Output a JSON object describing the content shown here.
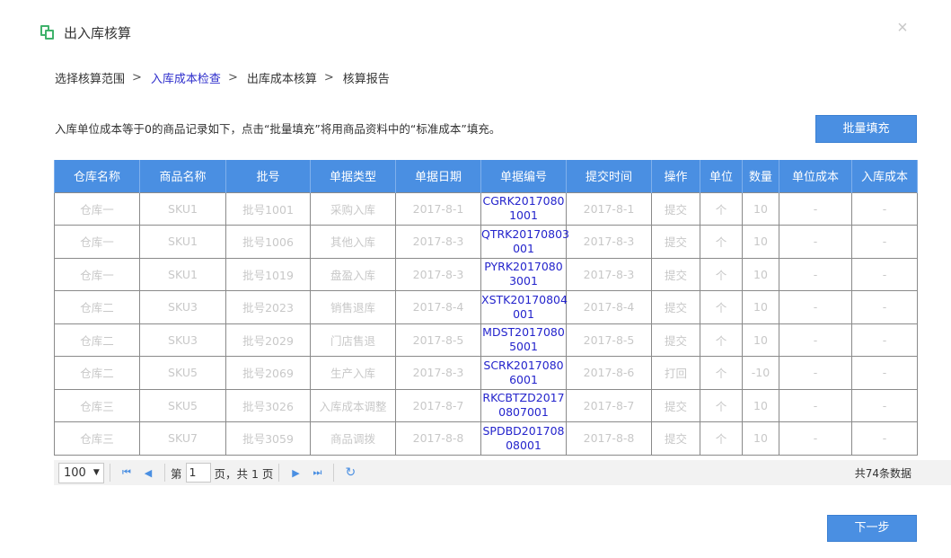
{
  "dialog": {
    "title": "出入库核算"
  },
  "breadcrumb": [
    {
      "label": "选择核算范围",
      "active": false
    },
    {
      "label": "入库成本检查",
      "active": true
    },
    {
      "label": "出库成本核算",
      "active": false
    },
    {
      "label": "核算报告",
      "active": false
    }
  ],
  "breadcrumb_sep": ">",
  "description": "入库单位成本等于0的商品记录如下，点击“批量填充”将用商品资料中的“标准成本”填充。",
  "buttons": {
    "batch_fill": "批量填充",
    "next": "下一步"
  },
  "table": {
    "headers": [
      "仓库名称",
      "商品名称",
      "批号",
      "单据类型",
      "单据日期",
      "单据编号",
      "提交时间",
      "操作",
      "单位",
      "数量",
      "单位成本",
      "入库成本"
    ],
    "rows": [
      {
        "warehouse": "仓库一",
        "sku": "SKU1",
        "batch": "批号1001",
        "type": "采购入库",
        "date": "2017-8-1",
        "doc_line1": "CGRK2017080",
        "doc_line2": "1001",
        "submit": "2017-8-1",
        "action": "提交",
        "unit": "个",
        "qty": "10",
        "unit_cost": "-",
        "in_cost": "-"
      },
      {
        "warehouse": "仓库一",
        "sku": "SKU1",
        "batch": "批号1006",
        "type": "其他入库",
        "date": "2017-8-3",
        "doc_line1": "QTRK20170803",
        "doc_line2": "001",
        "submit": "2017-8-3",
        "action": "提交",
        "unit": "个",
        "qty": "10",
        "unit_cost": "-",
        "in_cost": "-"
      },
      {
        "warehouse": "仓库一",
        "sku": "SKU1",
        "batch": "批号1019",
        "type": "盘盈入库",
        "date": "2017-8-3",
        "doc_line1": "PYRK2017080",
        "doc_line2": "3001",
        "submit": "2017-8-3",
        "action": "提交",
        "unit": "个",
        "qty": "10",
        "unit_cost": "-",
        "in_cost": "-"
      },
      {
        "warehouse": "仓库二",
        "sku": "SKU3",
        "batch": "批号2023",
        "type": "销售退库",
        "date": "2017-8-4",
        "doc_line1": "XSTK20170804",
        "doc_line2": "001",
        "submit": "2017-8-4",
        "action": "提交",
        "unit": "个",
        "qty": "10",
        "unit_cost": "-",
        "in_cost": "-"
      },
      {
        "warehouse": "仓库二",
        "sku": "SKU3",
        "batch": "批号2029",
        "type": "门店售退",
        "date": "2017-8-5",
        "doc_line1": "MDST2017080",
        "doc_line2": "5001",
        "submit": "2017-8-5",
        "action": "提交",
        "unit": "个",
        "qty": "10",
        "unit_cost": "-",
        "in_cost": "-"
      },
      {
        "warehouse": "仓库二",
        "sku": "SKU5",
        "batch": "批号2069",
        "type": "生产入库",
        "date": "2017-8-3",
        "doc_line1": "SCRK2017080",
        "doc_line2": "6001",
        "submit": "2017-8-6",
        "action": "打回",
        "unit": "个",
        "qty": "-10",
        "unit_cost": "-",
        "in_cost": "-"
      },
      {
        "warehouse": "仓库三",
        "sku": "SKU5",
        "batch": "批号3026",
        "type": "入库成本调整",
        "date": "2017-8-7",
        "doc_line1": "RKCBTZD2017",
        "doc_line2": "0807001",
        "submit": "2017-8-7",
        "action": "提交",
        "unit": "个",
        "qty": "10",
        "unit_cost": "-",
        "in_cost": "-"
      },
      {
        "warehouse": "仓库三",
        "sku": "SKU7",
        "batch": "批号3059",
        "type": "商品调拨",
        "date": "2017-8-8",
        "doc_line1": "SPDBD201708",
        "doc_line2": "08001",
        "submit": "2017-8-8",
        "action": "提交",
        "unit": "个",
        "qty": "10",
        "unit_cost": "-",
        "in_cost": "-"
      }
    ]
  },
  "pager": {
    "page_size": "100",
    "page_prefix": "第",
    "current_page": "1",
    "page_suffix": "页，共 1 页",
    "total": "共74条数据"
  },
  "icons": {
    "first": "first-page-icon",
    "prev": "prev-page-icon",
    "next": "next-page-icon",
    "last": "last-page-icon",
    "refresh": "refresh-icon"
  },
  "colors": {
    "accent": "#4a8fe2",
    "link": "#2424cc",
    "title_icon": "#3fb26b",
    "muted": "#c8c8c8"
  }
}
